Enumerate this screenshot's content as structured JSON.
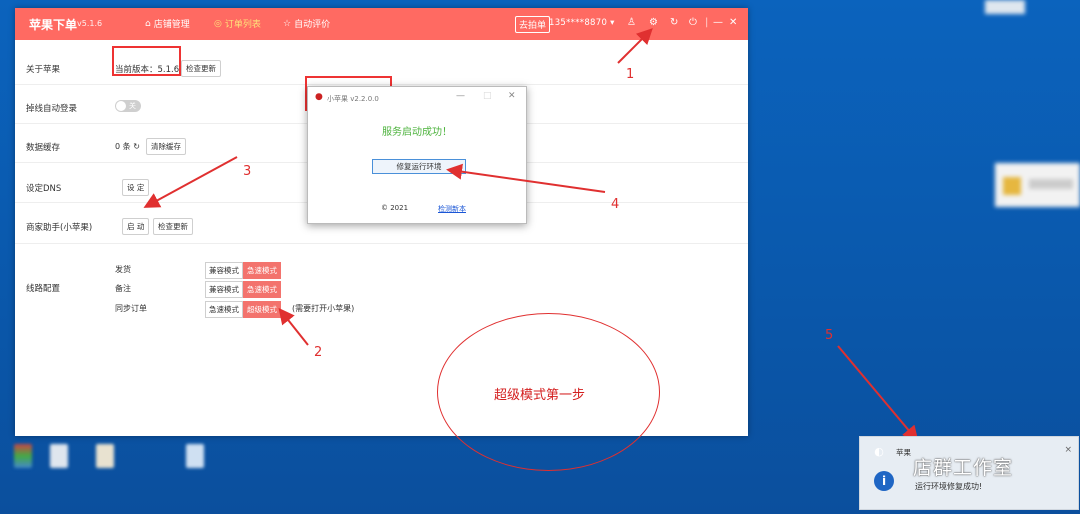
{
  "app": {
    "brand": "苹果下单",
    "version": "v5.1.6",
    "tabs": [
      {
        "label": "店铺管理",
        "icon": "shop-icon"
      },
      {
        "label": "订单列表",
        "icon": "order-icon"
      },
      {
        "label": "自动评价",
        "icon": "star-icon"
      }
    ],
    "grab_label": "去拍单",
    "account": "135****8870",
    "colors": {
      "title_bar": "#ff6a62",
      "accent": "#f3736d",
      "active_tab": "#ffe27a"
    }
  },
  "settings": {
    "about_label": "关于苹果",
    "current_version": "当前版本：5.1.6",
    "check_update": "检查更新",
    "auto_login_label": "掉线自动登录",
    "toggle_text": "关",
    "cache_label": "数据缓存",
    "cache_count": "0 条",
    "clear_cache": "清除缓存",
    "dns_label": "设定DNS",
    "dns_btn": "设 定",
    "helper_label": "商家助手(小苹果)",
    "start_btn": "启 动",
    "helper_update": "检查更新",
    "route_label": "线路配置",
    "routes": [
      {
        "label": "发货",
        "options": [
          "兼容模式",
          "急速模式"
        ],
        "active": 1
      },
      {
        "label": "备注",
        "options": [
          "兼容模式",
          "急速模式"
        ],
        "active": 1
      },
      {
        "label": "同步订单",
        "options": [
          "急速模式",
          "超级模式"
        ],
        "active": 1,
        "note": "(需要打开小苹果)"
      }
    ]
  },
  "dialog": {
    "title": "小苹果 v2.2.0.0",
    "success": "服务启动成功！",
    "repair_btn": "修复运行环境",
    "copyright": "© 2021",
    "check_link": "检测新本"
  },
  "annotations": {
    "step_text": "超级模式第一步",
    "numbers": [
      "1",
      "2",
      "3",
      "4",
      "5"
    ]
  },
  "toast": {
    "app_name": "苹果",
    "message": "运行环境修复成功!",
    "close": "×",
    "watermark": "店群工作室"
  }
}
